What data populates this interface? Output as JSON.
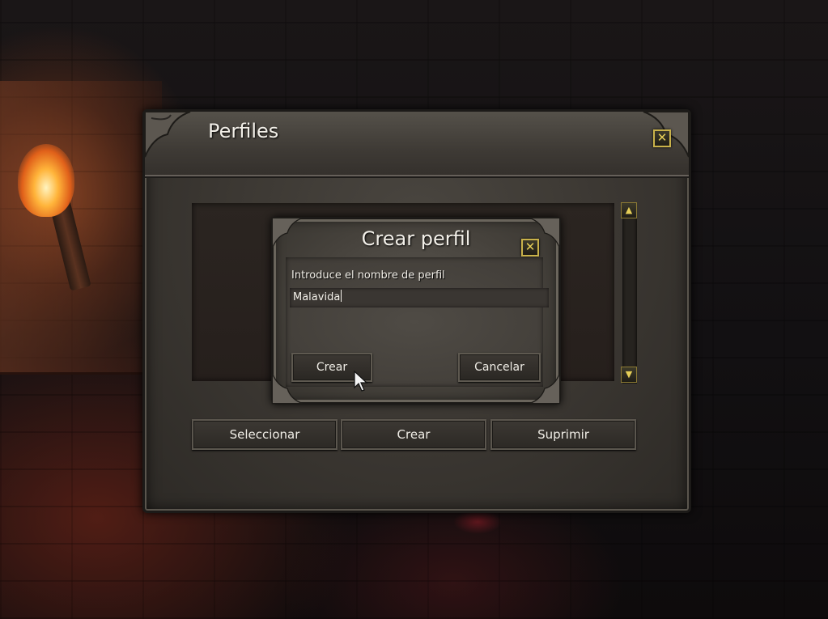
{
  "panel": {
    "title": "Perfiles",
    "close_icon": "✕",
    "buttons": {
      "select": "Seleccionar",
      "create": "Crear",
      "delete": "Suprimir"
    },
    "scroll_up_icon": "▲",
    "scroll_down_icon": "▼"
  },
  "dialog": {
    "title": "Crear perfil",
    "close_icon": "✕",
    "prompt": "Introduce el nombre de perfil",
    "input_value": "Malavida",
    "buttons": {
      "create": "Crear",
      "cancel": "Cancelar"
    }
  },
  "colors": {
    "close_accent": "#c9b24a",
    "panel_stone": "#3a3631",
    "text": "#f2efe8"
  }
}
